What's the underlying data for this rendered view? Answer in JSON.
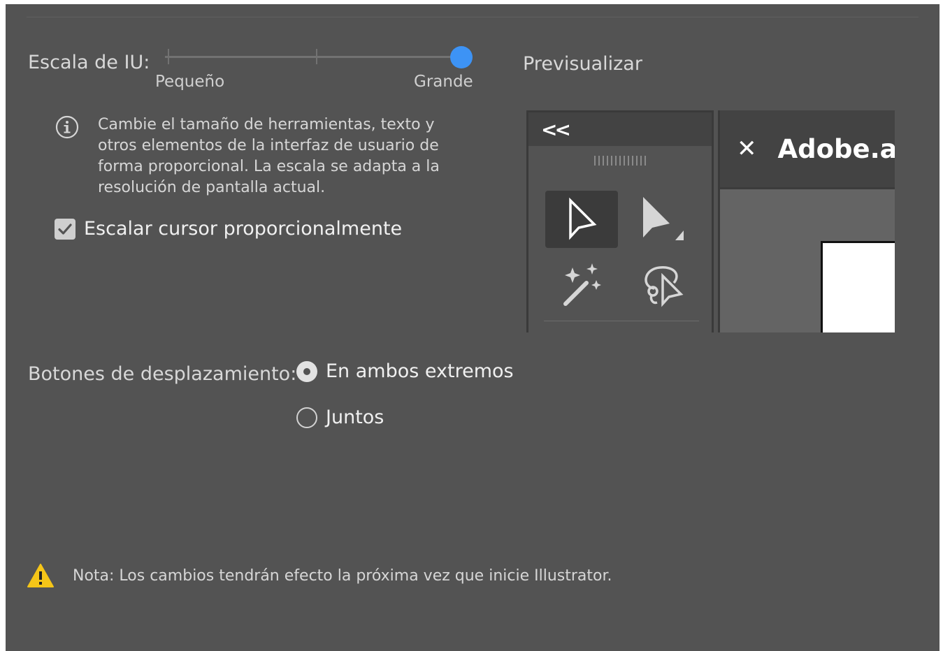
{
  "ui_scale": {
    "label": "Escala de IU:",
    "min_label": "Pequeño",
    "max_label": "Grande",
    "value_fraction": 1.0
  },
  "description": "Cambie el tamaño de herramientas, texto y otros elementos de la interfaz de usuario de forma proporcional. La escala se adapta a la resolución de pantalla actual.",
  "scale_cursor": {
    "label": "Escalar cursor proporcionalmente",
    "checked": true
  },
  "preview": {
    "label": "Previsualizar",
    "collapse_glyph": "<<",
    "close_glyph": "✕",
    "doc_title": "Adobe.a",
    "tools": [
      "selection-tool-icon",
      "direct-selection-tool-icon",
      "magic-wand-tool-icon",
      "lasso-tool-icon"
    ]
  },
  "scroll_buttons": {
    "label": "Botones de desplazamiento:",
    "options": [
      {
        "label": "En ambos extremos",
        "selected": true
      },
      {
        "label": "Juntos",
        "selected": false
      }
    ]
  },
  "note": "Nota:  Los cambios tendrán efecto la próxima vez que inicie Illustrator.",
  "colors": {
    "background": "#535353",
    "accent": "#3d93f5",
    "warning": "#f5c518"
  }
}
